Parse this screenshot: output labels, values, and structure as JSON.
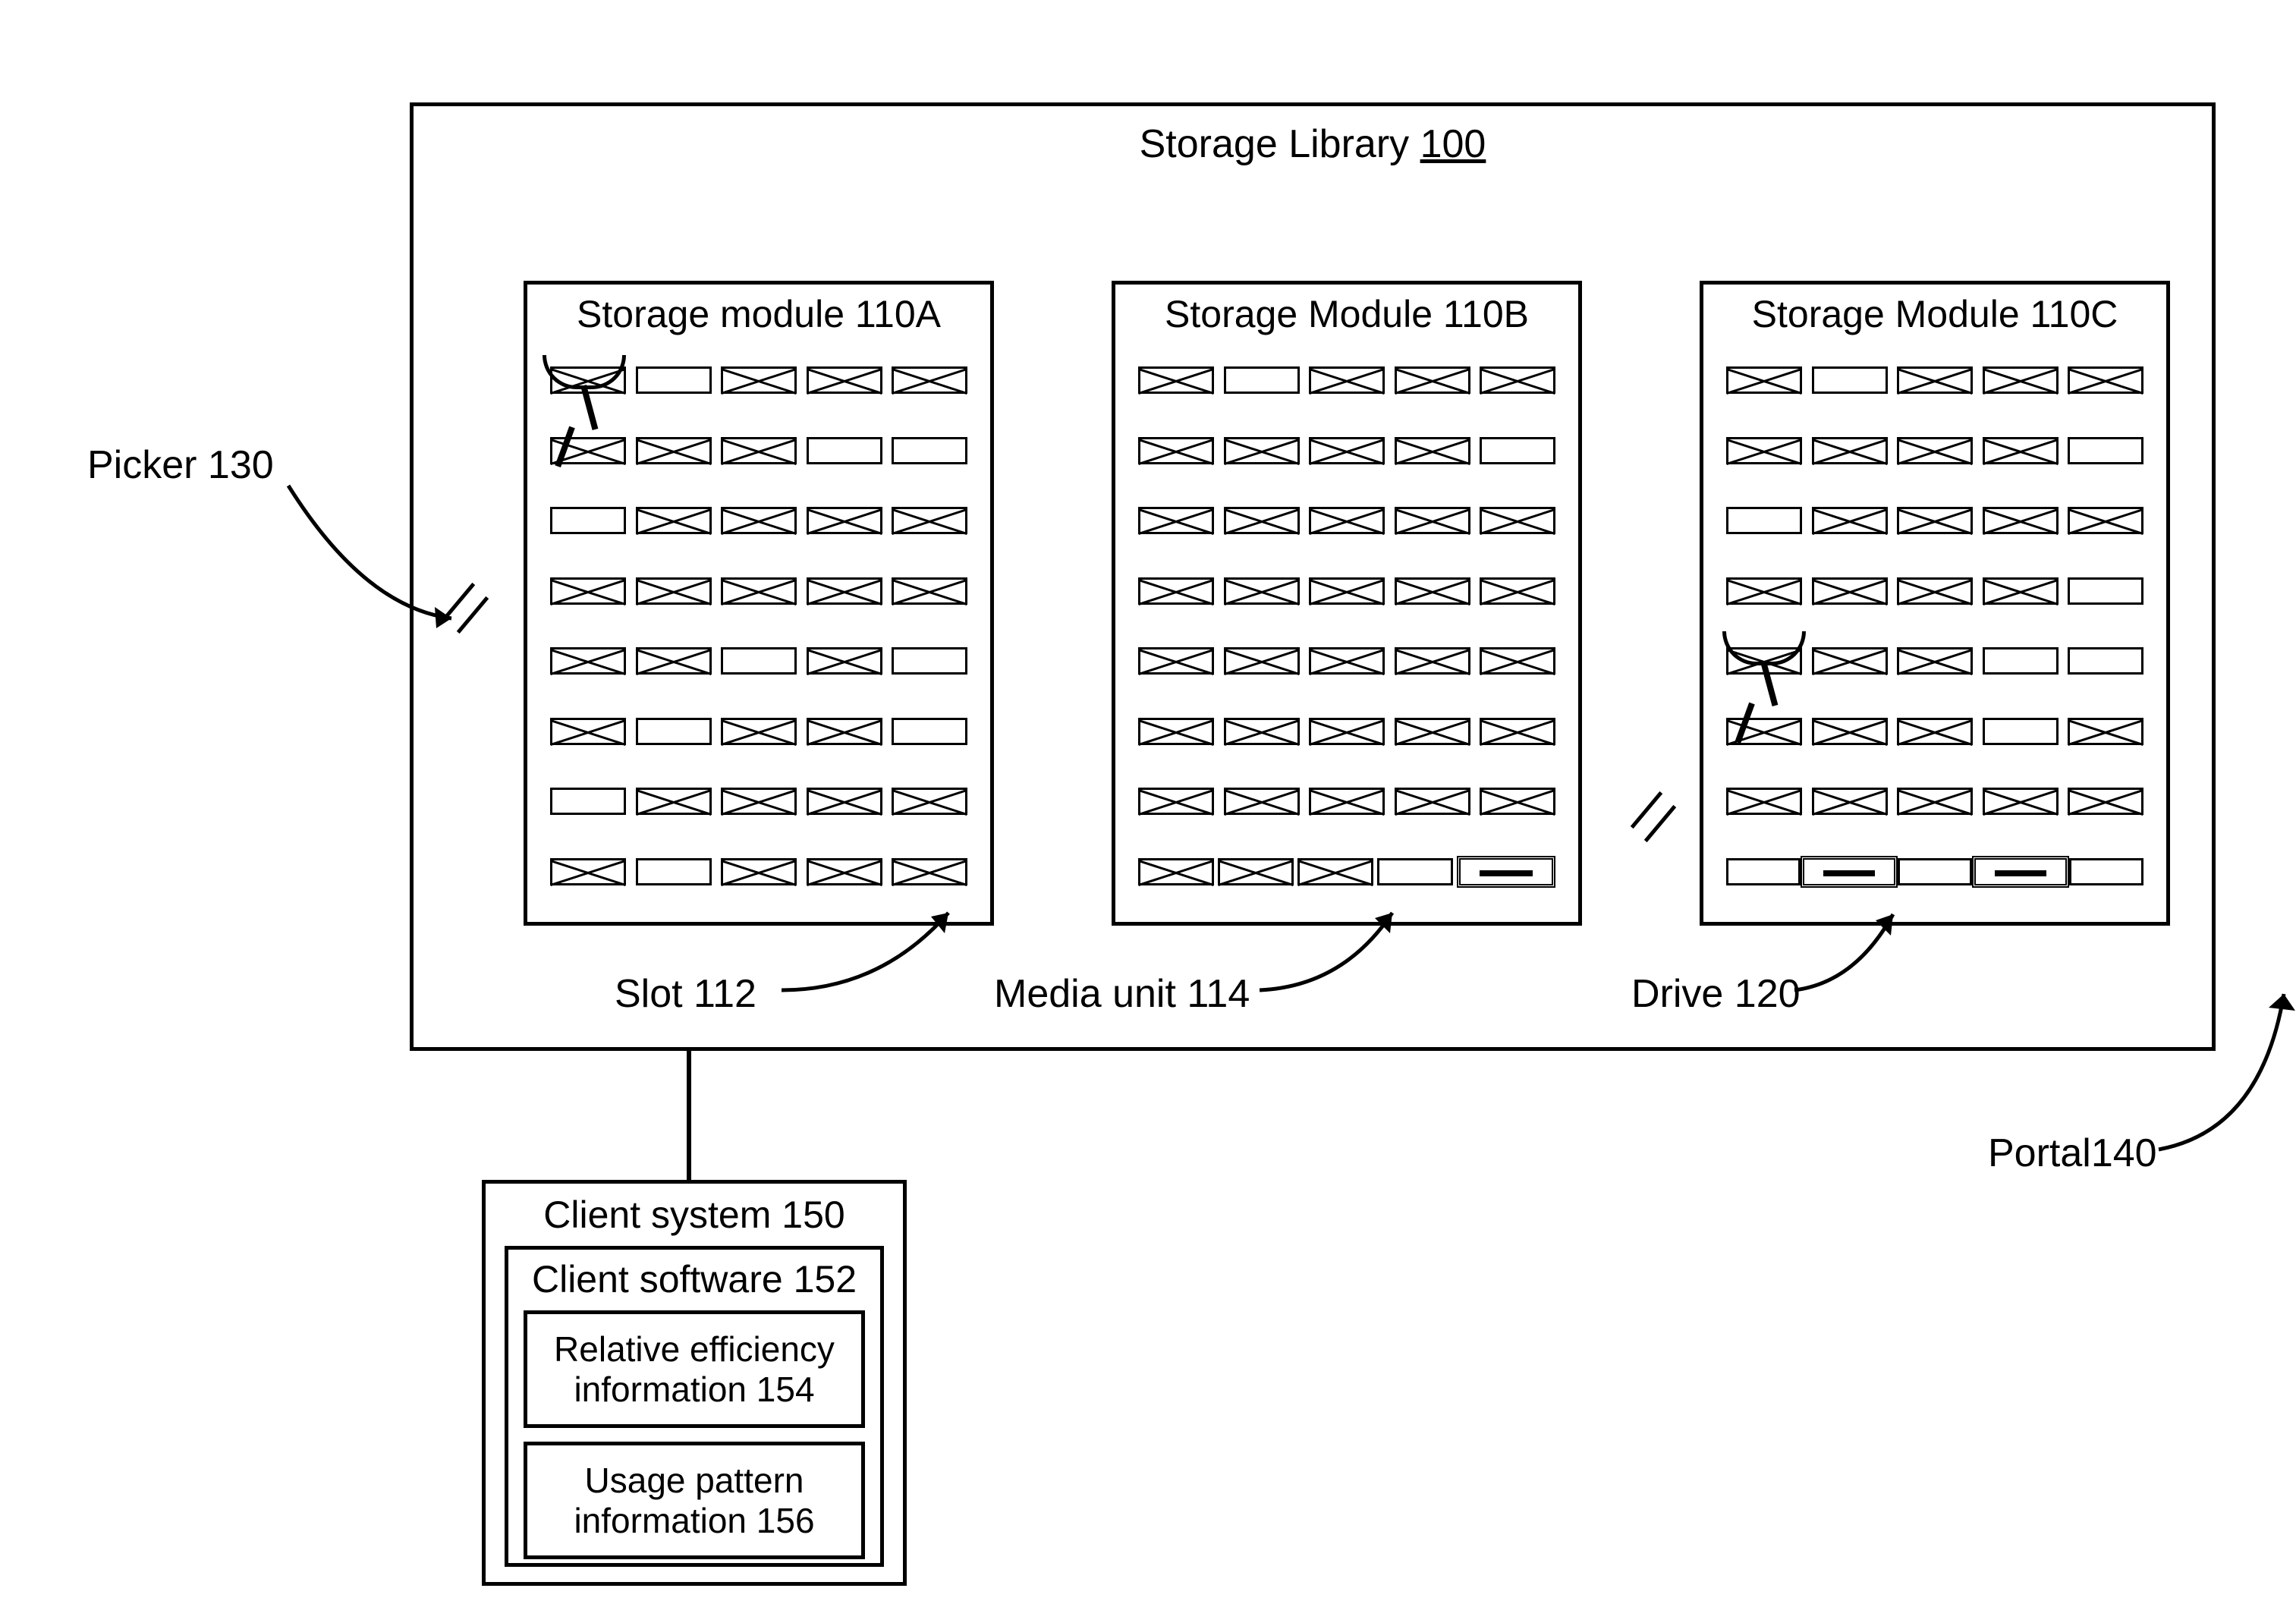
{
  "library": {
    "title": "Storage Library ",
    "num": "100"
  },
  "modules": {
    "a": {
      "title": "Storage module ",
      "num": "110A"
    },
    "b": {
      "title": "Storage Module ",
      "num": "110B"
    },
    "c": {
      "title": "Storage Module 110C"
    }
  },
  "callouts": {
    "picker": {
      "label": "Picker 130"
    },
    "slot": {
      "label": "Slot 112"
    },
    "media": {
      "label": "Media unit 114"
    },
    "drive": {
      "label": "Drive 120"
    },
    "portal": {
      "label": "Portal140"
    }
  },
  "client": {
    "title": "Client system ",
    "num": "150",
    "software": {
      "title": "Client software ",
      "num": "152"
    },
    "eff": {
      "line1": "Relative efficiency",
      "line2": "information ",
      "num": "154"
    },
    "usage": {
      "line1": "Usage pattern",
      "line2": "information ",
      "num": "156"
    }
  },
  "modA_rows": [
    [
      1,
      0,
      1,
      1,
      1
    ],
    [
      1,
      1,
      1,
      0,
      0
    ],
    [
      0,
      1,
      1,
      1,
      1
    ],
    [
      1,
      1,
      1,
      1,
      1
    ],
    [
      1,
      1,
      0,
      1,
      0
    ],
    [
      1,
      0,
      1,
      1,
      0
    ],
    [
      0,
      1,
      1,
      1,
      1
    ],
    [
      1,
      0,
      1,
      1,
      1
    ]
  ],
  "modB_rows": [
    [
      1,
      0,
      1,
      1,
      1
    ],
    [
      1,
      1,
      1,
      1,
      0
    ],
    [
      1,
      1,
      1,
      1,
      1
    ],
    [
      1,
      1,
      1,
      1,
      1
    ],
    [
      1,
      1,
      1,
      1,
      1
    ],
    [
      1,
      1,
      1,
      1,
      1
    ],
    [
      1,
      1,
      1,
      1,
      1
    ],
    [
      1,
      1,
      1,
      0,
      2
    ]
  ],
  "modC_rows": [
    [
      1,
      0,
      1,
      1,
      1
    ],
    [
      1,
      1,
      1,
      1,
      0
    ],
    [
      0,
      1,
      1,
      1,
      1
    ],
    [
      1,
      1,
      1,
      1,
      0
    ],
    [
      1,
      1,
      1,
      0,
      0
    ],
    [
      1,
      1,
      1,
      0,
      1
    ],
    [
      1,
      1,
      1,
      1,
      1
    ],
    [
      0,
      2,
      0,
      2,
      0
    ]
  ]
}
